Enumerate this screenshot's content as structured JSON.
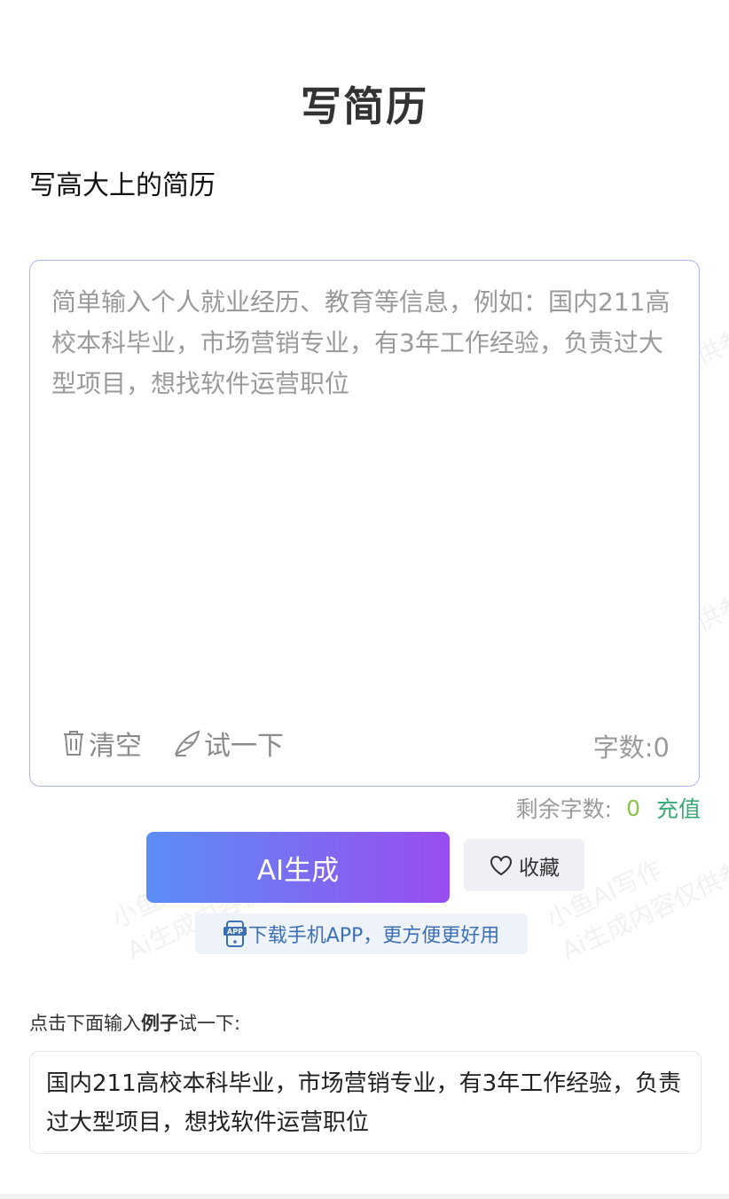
{
  "header": {
    "title": "写简历",
    "subtitle": "写高大上的简历"
  },
  "input": {
    "placeholder": "简单输入个人就业经历、教育等信息，例如：国内211高校本科毕业，市场营销专业，有3年工作经验，负责过大型项目，想找软件运营职位",
    "value": ""
  },
  "toolbar": {
    "clear_label": "清空",
    "try_label": "试一下",
    "char_count_label": "字数:",
    "char_count": "0"
  },
  "quota": {
    "label": "剩余字数:",
    "value": "0",
    "recharge_label": "充值"
  },
  "actions": {
    "generate_label": "AI生成",
    "favorite_label": "收藏",
    "download_label": "下载手机APP，更方便更好用"
  },
  "example": {
    "hint_prefix": "点击下面输入",
    "hint_bold": "例子",
    "hint_suffix": "试一下:",
    "text": "国内211高校本科毕业，市场营销专业，有3年工作经验，负责过大型项目，想找软件运营职位"
  },
  "watermark": {
    "line1": "小鱼AI写作",
    "line2": "Ai生成内容仅供参考"
  },
  "colors": {
    "accent_start": "#5b8ef5",
    "accent_end": "#9a4df0",
    "quota_value": "#8bc34a",
    "recharge": "#3aa876",
    "link_blue": "#3d6fb5"
  }
}
